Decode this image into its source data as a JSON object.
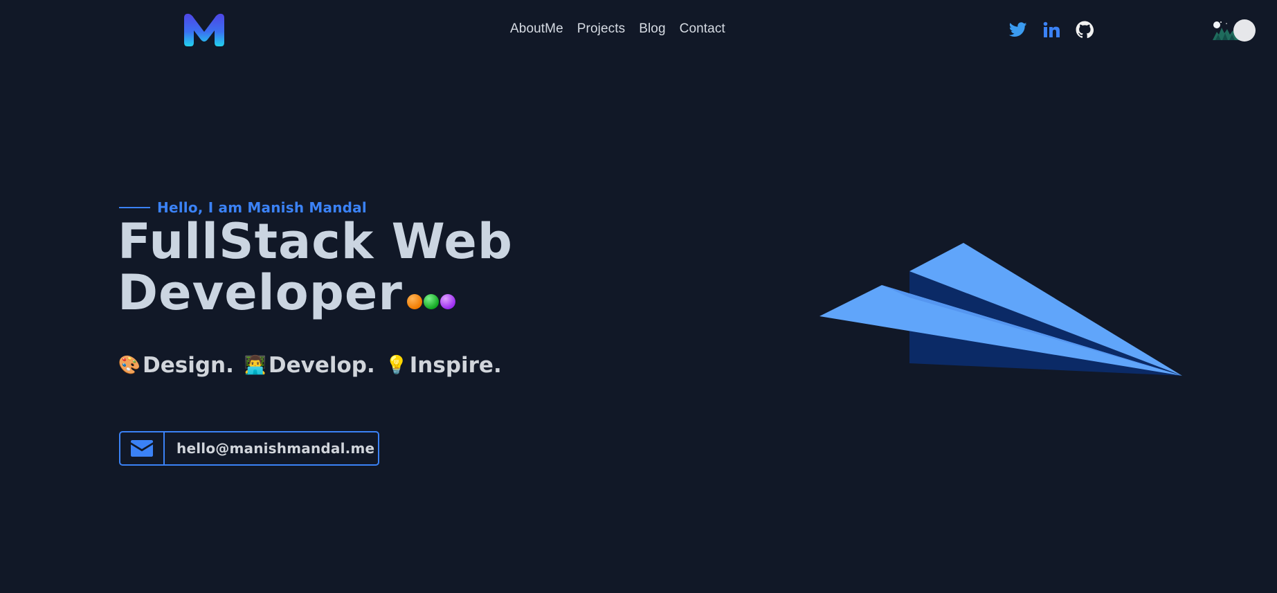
{
  "header": {
    "logo_letter": "M",
    "nav": [
      "AboutMe",
      "Projects",
      "Blog",
      "Contact"
    ],
    "socials": [
      "twitter-icon",
      "linkedin-icon",
      "github-icon"
    ]
  },
  "hero": {
    "greeting": "Hello, I am Manish Mandal",
    "headline_line1": "FullStack Web",
    "headline_line2": "Developer",
    "tagline": [
      {
        "emoji": "🎨",
        "text": "Design."
      },
      {
        "emoji": "👨‍💻",
        "text": "Develop."
      },
      {
        "emoji": "💡",
        "text": "Inspire."
      }
    ],
    "email": "hello@manishmandal.me"
  },
  "colors": {
    "background": "#111827",
    "accent": "#3b82f6",
    "heading": "#cbd5e1",
    "plane_light": "#60a5fa",
    "plane_dark": "#0b2a66"
  }
}
